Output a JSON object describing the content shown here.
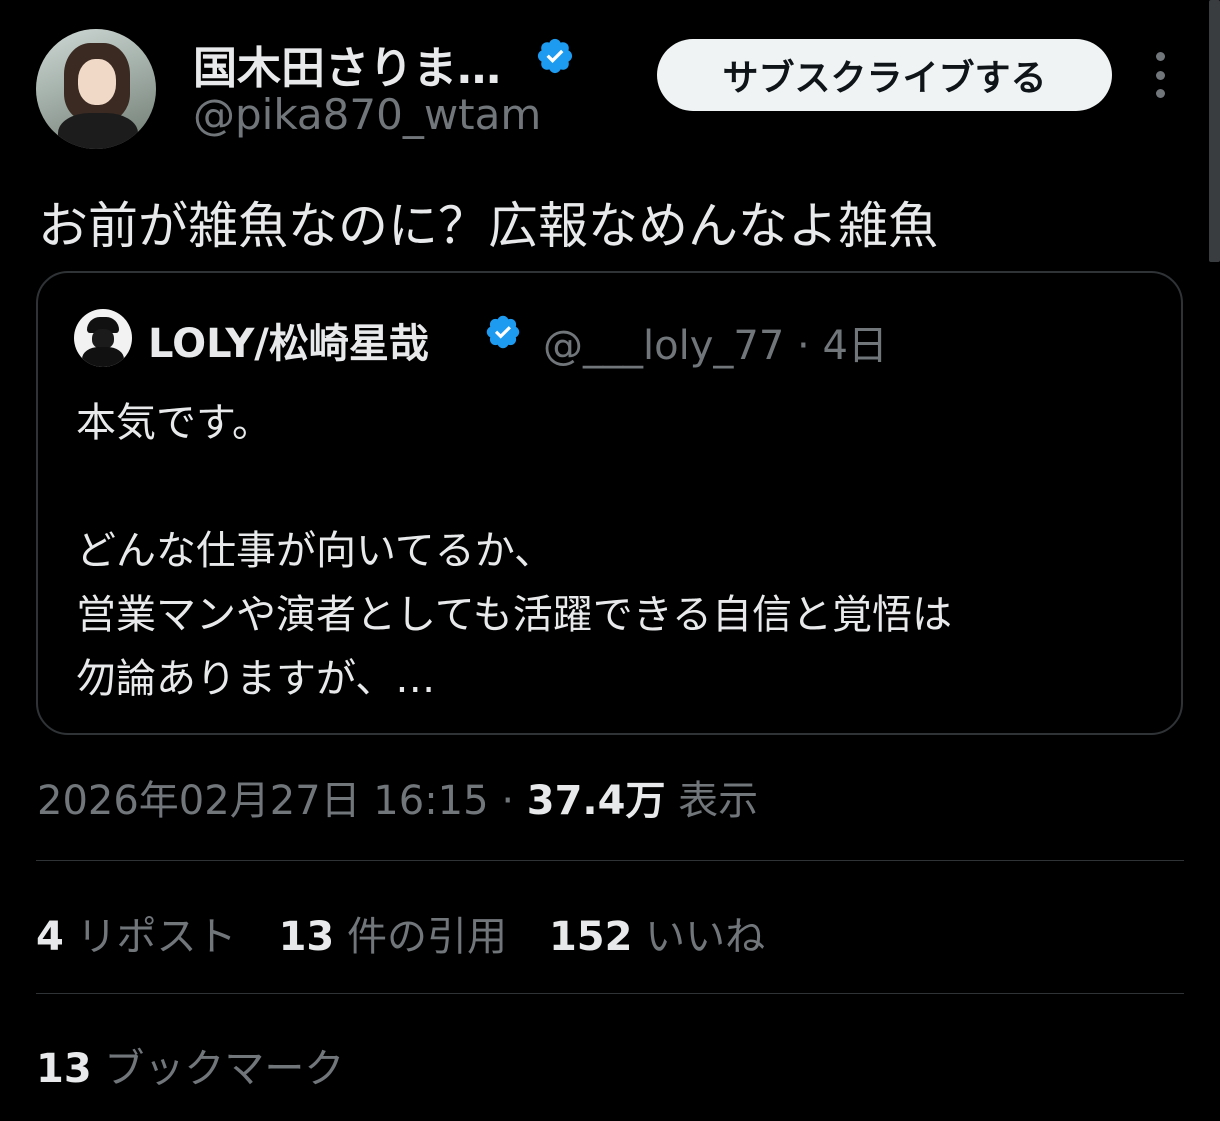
{
  "author": {
    "display_name": "国木田さりま…",
    "handle": "@pika870_wtam",
    "verified_color": "#1d9bf0"
  },
  "subscribe_label": "サブスクライブする",
  "more_icon": "more-vertical-icon",
  "tweet_text": "お前が雑魚なのに？広報なめんなよ雑魚",
  "quote": {
    "name": "LOLY/松崎星哉",
    "handle": "@___loly_77",
    "separator": "·",
    "age": "4日",
    "lines": [
      "本気です。",
      "",
      "どんな仕事が向いてるか、",
      "営業マンや演者としても活躍できる自信と覚悟は",
      "勿論ありますが、…"
    ]
  },
  "meta": {
    "timestamp": "2026年02月27日 16:15",
    "separator": "·",
    "views_count": "37.4万",
    "views_label": "表示"
  },
  "stats": {
    "reposts_count": "4",
    "reposts_label": "リポスト",
    "quotes_count": "13",
    "quotes_label": "件の引用",
    "likes_count": "152",
    "likes_label": "いいね",
    "bookmarks_count": "13",
    "bookmarks_label": "ブックマーク"
  },
  "colors": {
    "background": "#000000",
    "text_primary": "#e7e9ea",
    "text_secondary": "#71767b",
    "border": "#2f3336",
    "verified": "#1d9bf0"
  }
}
